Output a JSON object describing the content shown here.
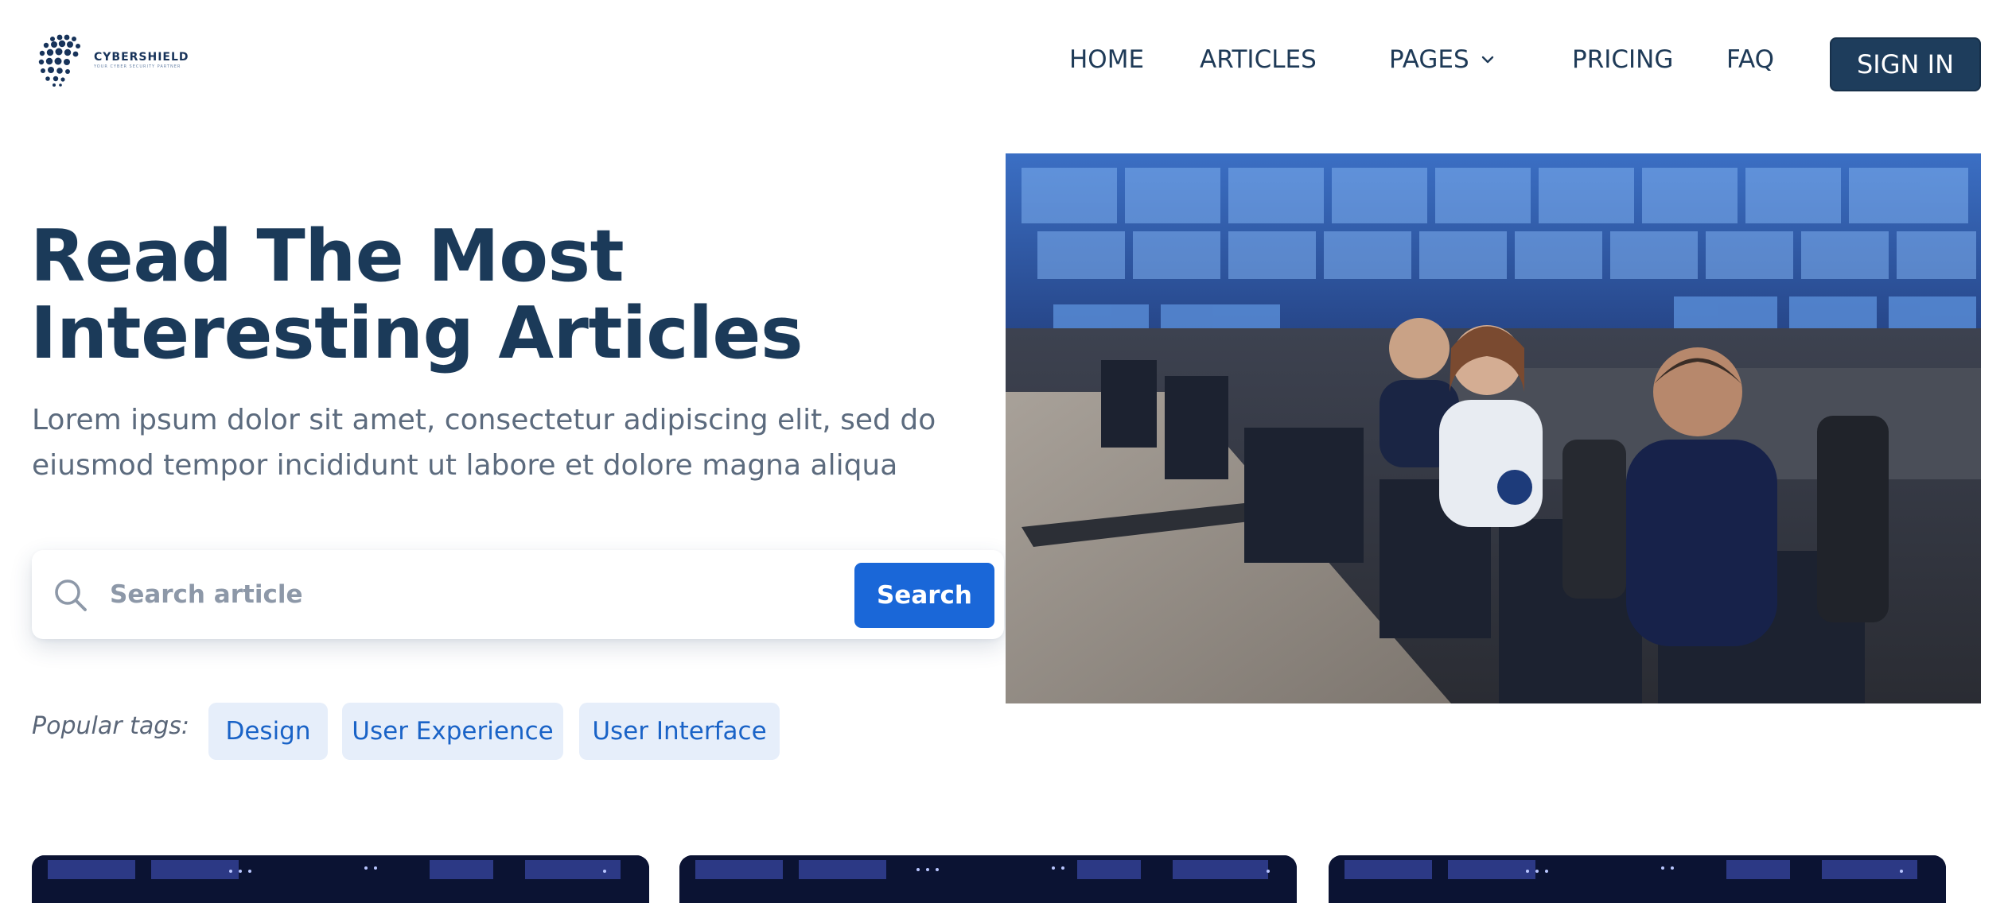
{
  "brand": {
    "name": "CYBERSHIELD",
    "tagline": "YOUR CYBER SECURITY PARTNER"
  },
  "nav": {
    "items": [
      {
        "label": "HOME"
      },
      {
        "label": "ARTICLES"
      },
      {
        "label": "PAGES",
        "has_dropdown": true
      },
      {
        "label": "PRICING"
      },
      {
        "label": "FAQ"
      }
    ],
    "signin_label": "SIGN IN"
  },
  "hero": {
    "title_line1": "Read The Most",
    "title_line2": "Interesting Articles",
    "subtitle_line1": "Lorem ipsum dolor sit amet, consectetur adipiscing elit, sed do",
    "subtitle_line2": "eiusmod tempor incididunt ut labore et dolore magna aliqua",
    "image_alt": "security operations center with staff at monitors"
  },
  "search": {
    "placeholder": "Search article",
    "button_label": "Search"
  },
  "tags": {
    "label": "Popular tags:",
    "items": [
      "Design",
      "User Experience",
      "User Interface"
    ]
  },
  "colors": {
    "primary_dark": "#1e3d5c",
    "accent_blue": "#1a67d8",
    "tag_bg": "#e6eefa",
    "tag_text": "#1a63c7",
    "muted_text": "#5c6b7e"
  },
  "icons": {
    "search": "search-icon",
    "chevron": "chevron-down-icon",
    "logo": "globe-dots-logo"
  }
}
